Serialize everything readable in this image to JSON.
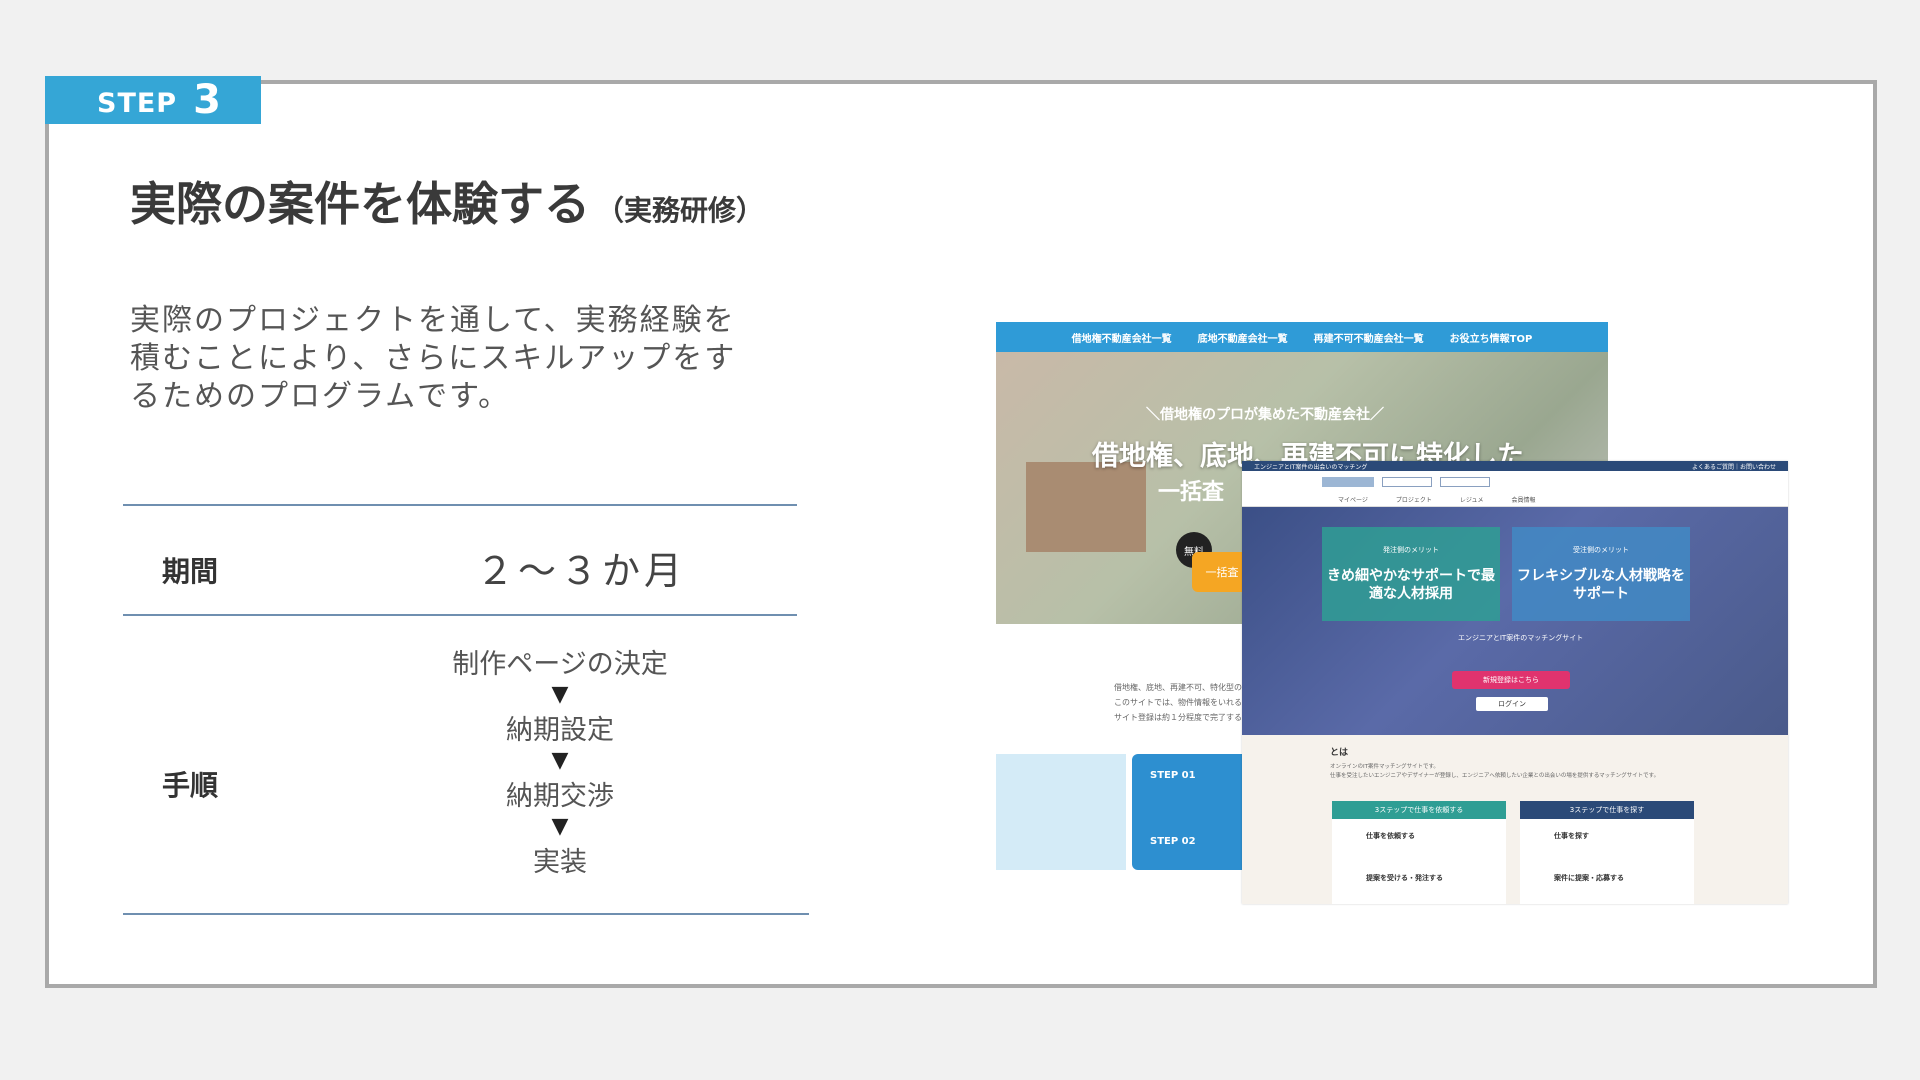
{
  "step": {
    "label": "STEP",
    "number": "3"
  },
  "title": {
    "main": "実際の案件を体験する",
    "sub": "（実務研修）"
  },
  "description": "実際のプロジェクトを通して、実務経験を積むことにより、さらにスキルアップをするためのプログラムです。",
  "table": {
    "period_label": "期間",
    "period_value": "２～３か月",
    "procedure_label": "手順",
    "steps": [
      "制作ページの決定",
      "納期設定",
      "納期交渉",
      "実装"
    ],
    "arrow": "▼"
  },
  "screenshot1": {
    "nav": [
      "借地権不動産会社一覧",
      "底地不動産会社一覧",
      "再建不可不動産会社一覧",
      "お役立ち情報TOP"
    ],
    "tagline": "＼借地権のプロが集めた不動産会社／",
    "headline": "借地権、底地、再建不可に特化した",
    "headline2": "一括査",
    "free_badge": "無料",
    "cta": "一括査",
    "body_text": [
      "借地権、底地、再建不可、特化型のサイ",
      "このサイトでは、物件情報をいれるだ",
      "サイト登録は約１分程度で完了する"
    ],
    "step1": "STEP 01",
    "step2": "STEP 02"
  },
  "screenshot2": {
    "top_left": "エンジニアとIT案件の出会いのマッチング",
    "top_right": "よくあるご質問｜お問い合わせ",
    "menu": [
      "マイページ",
      "プロジェクト",
      "レジュメ",
      "会員情報"
    ],
    "box1_meta": "発注側のメリット",
    "box1_title": "きめ細やかなサポートで最適な人材採用",
    "box2_meta": "受注側のメリット",
    "box2_title": "フレキシブルな人材戦略をサポート",
    "sub": "エンジニアとIT案件のマッチングサイト",
    "signup": "新規登録はこちら",
    "login": "ログイン",
    "about": "とは",
    "about_text": [
      "オンラインのIT案件マッチングサイトです。",
      "仕事を受注したいエンジニアやデザイナーが登録し、エンジニアへ依頼したい企業との出会いの場を提供するマッチングサイトです。"
    ],
    "col1_head": "3ステップで仕事を依頼する",
    "col1_item": "仕事を依頼する",
    "col1_item2": "提案を受ける・発注する",
    "col2_head": "3ステップで仕事を探す",
    "col2_item": "仕事を探す",
    "col2_item2": "案件に提案・応募する",
    "colors": {
      "teal": "#2f9e94",
      "navy": "#2b4a78"
    }
  },
  "colors": {
    "accent": "#35a6d6",
    "rule": "#6f8fb0",
    "border": "#a9a9a9"
  }
}
